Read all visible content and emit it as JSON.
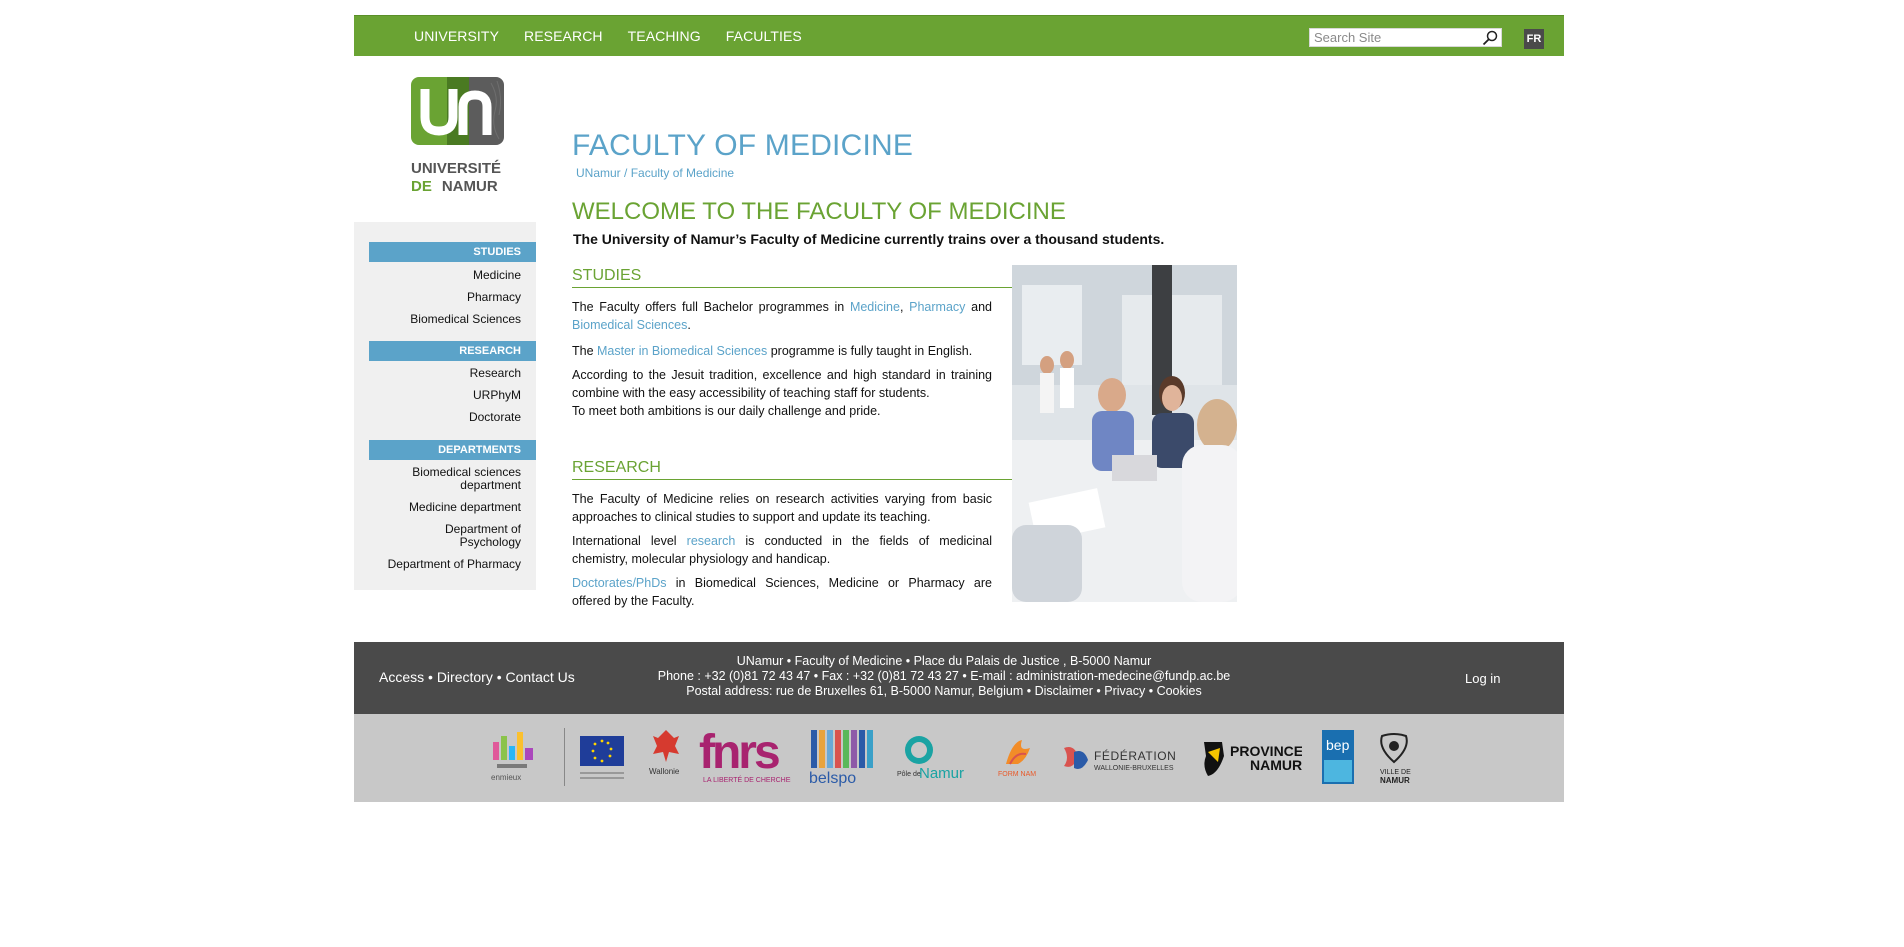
{
  "nav": {
    "items": [
      "UNIVERSITY",
      "RESEARCH",
      "TEACHING",
      "FACULTIES"
    ],
    "search_placeholder": "Search Site",
    "lang": "FR"
  },
  "logo": {
    "line1": "UNIVERSITÉ",
    "line2_a": "DE",
    "line2_b": "NAMUR"
  },
  "sidebar": {
    "sections": [
      {
        "head": "STUDIES",
        "items": [
          "Medicine",
          "Pharmacy",
          "Biomedical Sciences"
        ]
      },
      {
        "head": "RESEARCH",
        "items": [
          "Research",
          "URPhyM",
          "Doctorate"
        ]
      },
      {
        "head": "DEPARTMENTS",
        "items": [
          "Biomedical sciences department",
          "Medicine department",
          "Department of Psychology",
          "Department of Pharmacy"
        ]
      }
    ]
  },
  "main": {
    "title": "FACULTY OF MEDICINE",
    "breadcrumb": {
      "home": "UNamur",
      "sep": " / ",
      "current": "Faculty of Medicine"
    },
    "welcome": "WELCOME TO THE FACULTY OF MEDICINE",
    "intro": "The University of Namur’s Faculty of Medicine currently trains over a thousand students.",
    "studies": {
      "title": "STUDIES",
      "p1_a": "The Faculty offers full Bachelor programmes in ",
      "p1_link1": "Medicine",
      "p1_sep": ", ",
      "p1_link2": "Pharmacy",
      "p1_and": " and ",
      "p1_link3": "Biomedical Sciences",
      "p1_end": ".",
      "p2_a": "The ",
      "p2_link": "Master in Biomedical Sciences",
      "p2_b": " programme is fully taught in English.",
      "p3": "According to the Jesuit tradition, excellence and high standard in training combine with the easy accessibility of teaching staff for students.",
      "p4": "To meet both ambitions is our daily challenge and pride."
    },
    "research": {
      "title": "RESEARCH",
      "p1": "The Faculty of Medicine relies on research activities varying from basic approaches to clinical studies to support and update its teaching.",
      "p2_a": "International level ",
      "p2_link": "research",
      "p2_b": " is conducted in the fields of medicinal chemistry, molecular physiology and handicap.",
      "p3_link": "Doctorates/PhDs",
      "p3_b": " in Biomedical Sciences, Medicine or Pharmacy are offered by the Faculty."
    }
  },
  "footer": {
    "links": [
      "Access",
      "Directory",
      "Contact Us"
    ],
    "bullet": " • ",
    "line1": "UNamur • Faculty of Medicine • Place du Palais de Justice , B-5000 Namur",
    "line2": "Phone : +32 (0)81 72 43 47 • Fax : +32 (0)81 72 43 27 • E-mail : administration-medecine@fundp.ac.be",
    "line3_a": "Postal address: rue de Bruxelles 61, B-5000 Namur, Belgium • ",
    "line3_links": [
      "Disclaimer",
      "Privacy",
      "Cookies"
    ],
    "login": "Log in"
  },
  "partners": {
    "enmieux": "enmieux",
    "wallonie": "Wallonie",
    "fnrs": "fnrs",
    "fnrs_sub": "LA LIBERTÉ DE CHERCHER",
    "belspo": "belspo",
    "pole_a": "Pôle de",
    "pole_b": "Namur",
    "formanam": "FORM NAM",
    "federation_a": "FÉDÉRATION",
    "federation_b": "WALLONIE-BRUXELLES",
    "province_a": "PROVINCE",
    "province_b": "NAMUR",
    "bep": "bep",
    "ville_a": "VILLE DE",
    "ville_b": "NAMUR"
  },
  "colors": {
    "green": "#6aa333",
    "blue": "#5ba3c9",
    "dark": "#4a4a4a"
  }
}
